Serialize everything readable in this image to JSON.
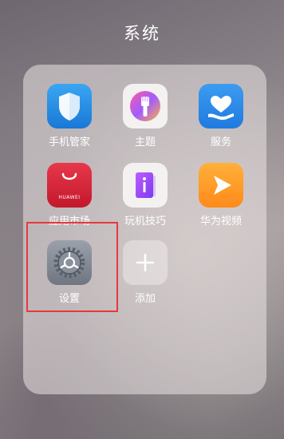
{
  "folder": {
    "title": "系统"
  },
  "apps": [
    {
      "label": "手机管家",
      "icon": "phone-manager-shield-icon"
    },
    {
      "label": "主题",
      "icon": "theme-brush-icon"
    },
    {
      "label": "服务",
      "icon": "service-heart-icon"
    },
    {
      "label": "应用市场",
      "icon": "appgallery-bag-icon",
      "brand_text": "HUAWEI"
    },
    {
      "label": "玩机技巧",
      "icon": "tips-i-icon"
    },
    {
      "label": "华为视频",
      "icon": "video-play-icon"
    },
    {
      "label": "设置",
      "icon": "settings-gear-icon"
    },
    {
      "label": "添加",
      "icon": "add-plus-icon"
    }
  ],
  "highlight": {
    "target": "设置",
    "color": "#e8383d"
  }
}
